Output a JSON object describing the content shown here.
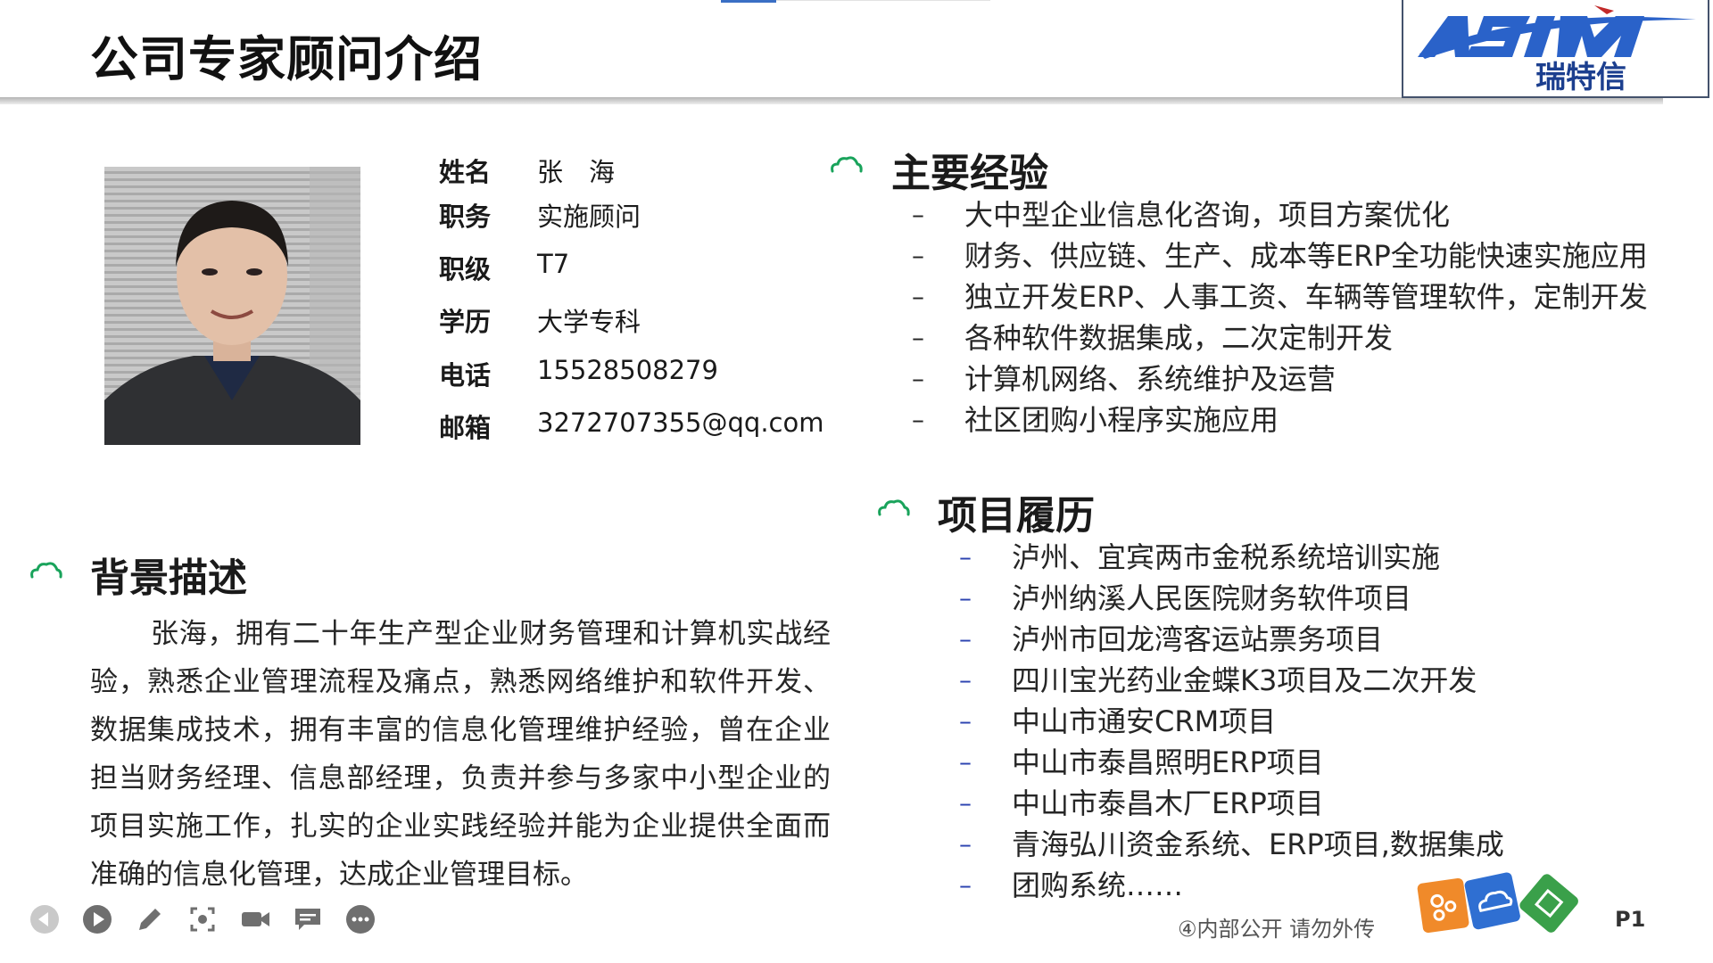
{
  "slide": {
    "title": "公司专家顾问介绍",
    "logo": {
      "brand": "ASIM",
      "chinese_name": "瑞特信",
      "brand_color": "#2a62c9"
    },
    "page_number": "P1",
    "footer_note": "④内部公开 请勿外传"
  },
  "profile": {
    "fields": [
      {
        "label": "姓名",
        "value": "张　海"
      },
      {
        "label": "职务",
        "value": "实施顾问"
      },
      {
        "label": "职级",
        "value": "T7"
      },
      {
        "label": "学历",
        "value": "大学专科"
      },
      {
        "label": "电话",
        "value": "15528508279"
      },
      {
        "label": "邮箱",
        "value": "3272707355@qq.com"
      }
    ]
  },
  "sections": {
    "experience": {
      "heading": "主要经验",
      "bullet": "–",
      "items": [
        "大中型企业信息化咨询，项目方案优化",
        "财务、供应链、生产、成本等ERP全功能快速实施应用",
        "独立开发ERP、人事工资、车辆等管理软件，定制开发",
        "各种软件数据集成，二次定制开发",
        "计算机网络、系统维护及运营",
        "社区团购小程序实施应用"
      ]
    },
    "projects": {
      "heading": "项目履历",
      "bullet": "–",
      "items": [
        "泸州、宜宾两市金税系统培训实施",
        "泸州纳溪人民医院财务软件项目",
        "泸州市回龙湾客运站票务项目",
        "四川宝光药业金蝶K3项目及二次开发",
        "中山市通安CRM项目",
        "中山市泰昌照明ERP项目",
        "中山市泰昌木厂ERP项目",
        "青海弘川资金系统、ERP项目,数据集成",
        "团购系统……"
      ]
    },
    "background": {
      "heading": "背景描述",
      "text": "张海，拥有二十年生产型企业财务管理和计算机实战经验，熟悉企业管理流程及痛点，熟悉网络维护和软件开发、数据集成技术，拥有丰富的信息化管理维护经验，曾在企业担当财务经理、信息部经理，负责并参与多家中小型企业的项目实施工作，扎实的企业实践经验并能为企业提供全面而准确的信息化管理，达成企业管理目标。"
    }
  },
  "toolbar": {
    "buttons": [
      "prev-icon",
      "play-icon",
      "pen-icon",
      "screenshot-icon",
      "camera-icon",
      "comment-icon",
      "more-icon"
    ]
  },
  "colors": {
    "accent_green": "#19a35b",
    "project_bullet": "#2b43b0",
    "header_rule": "#c4c4c4"
  }
}
